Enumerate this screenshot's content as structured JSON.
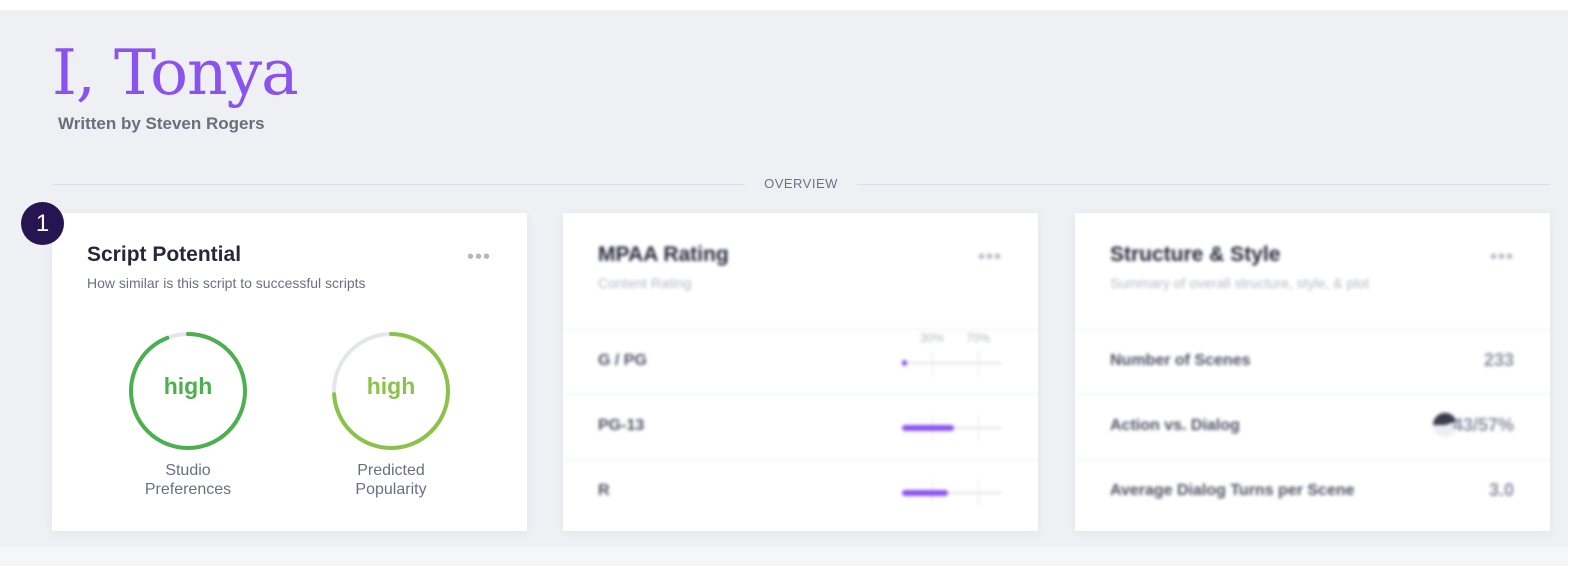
{
  "header": {
    "title": "I, Tonya",
    "subtitle": "Written by Steven Rogers"
  },
  "section": {
    "label": "OVERVIEW"
  },
  "colors": {
    "accent": "#8a52ee",
    "green_dark": "#4caf50",
    "green_light": "#8bc34a",
    "badge": "#261550"
  },
  "cards": {
    "script_potential": {
      "badge": "1",
      "title": "Script Potential",
      "subtitle": "How similar is this script to successful scripts",
      "menu": "•••",
      "gauges": [
        {
          "value": "high",
          "label_line1": "Studio",
          "label_line2": "Preferences",
          "fraction": 0.94,
          "color": "#4caf50"
        },
        {
          "value": "high",
          "label_line1": "Predicted",
          "label_line2": "Popularity",
          "fraction": 0.74,
          "color": "#8bc34a"
        }
      ]
    },
    "mpaa": {
      "title": "MPAA Rating",
      "subtitle": "Content Rating",
      "menu": "•••",
      "tick_labels": [
        "30%",
        "70%"
      ],
      "rows": [
        {
          "name": "G / PG",
          "fraction": 0.04
        },
        {
          "name": "PG-13",
          "fraction": 0.52
        },
        {
          "name": "R",
          "fraction": 0.46
        }
      ]
    },
    "structure": {
      "title": "Structure & Style",
      "subtitle": "Summary of overall structure, style, & plot",
      "menu": "•••",
      "rows": [
        {
          "name": "Number of Scenes",
          "value": "233",
          "icon": ""
        },
        {
          "name": "Action vs. Dialog",
          "value": "43/57%",
          "icon": "pie-chart-icon"
        },
        {
          "name": "Average Dialog Turns per Scene",
          "value": "3.0",
          "icon": ""
        }
      ]
    }
  }
}
